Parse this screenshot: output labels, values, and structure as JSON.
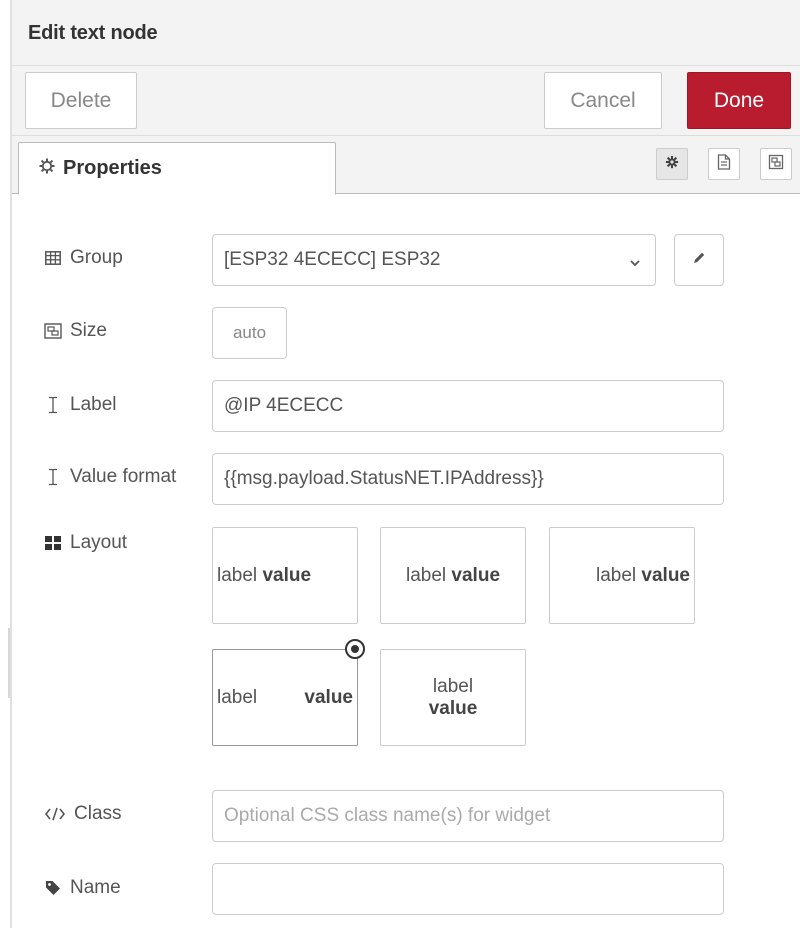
{
  "header": {
    "title": "Edit text node"
  },
  "actions": {
    "delete_label": "Delete",
    "cancel_label": "Cancel",
    "done_label": "Done",
    "done_color": "#b91c2e"
  },
  "tabs": {
    "properties_label": "Properties"
  },
  "form": {
    "group": {
      "label": "Group",
      "value": "[ESP32 4ECECC] ESP32"
    },
    "size": {
      "label": "Size",
      "value": "auto"
    },
    "label": {
      "label": "Label",
      "value": "@IP 4ECECC"
    },
    "value_format": {
      "label": "Value format",
      "value": "{{msg.payload.StatusNET.IPAddress}}"
    },
    "layout": {
      "label": "Layout",
      "selected_index": 3,
      "options": [
        {
          "label": "label",
          "value": "value"
        },
        {
          "label": "label",
          "value": "value"
        },
        {
          "label": "label",
          "value": "value"
        },
        {
          "label": "label",
          "value": "value"
        },
        {
          "label": "label",
          "value": "value"
        }
      ]
    },
    "class": {
      "label": "Class",
      "placeholder": "Optional CSS class name(s) for widget",
      "value": ""
    },
    "name": {
      "label": "Name",
      "value": ""
    }
  }
}
